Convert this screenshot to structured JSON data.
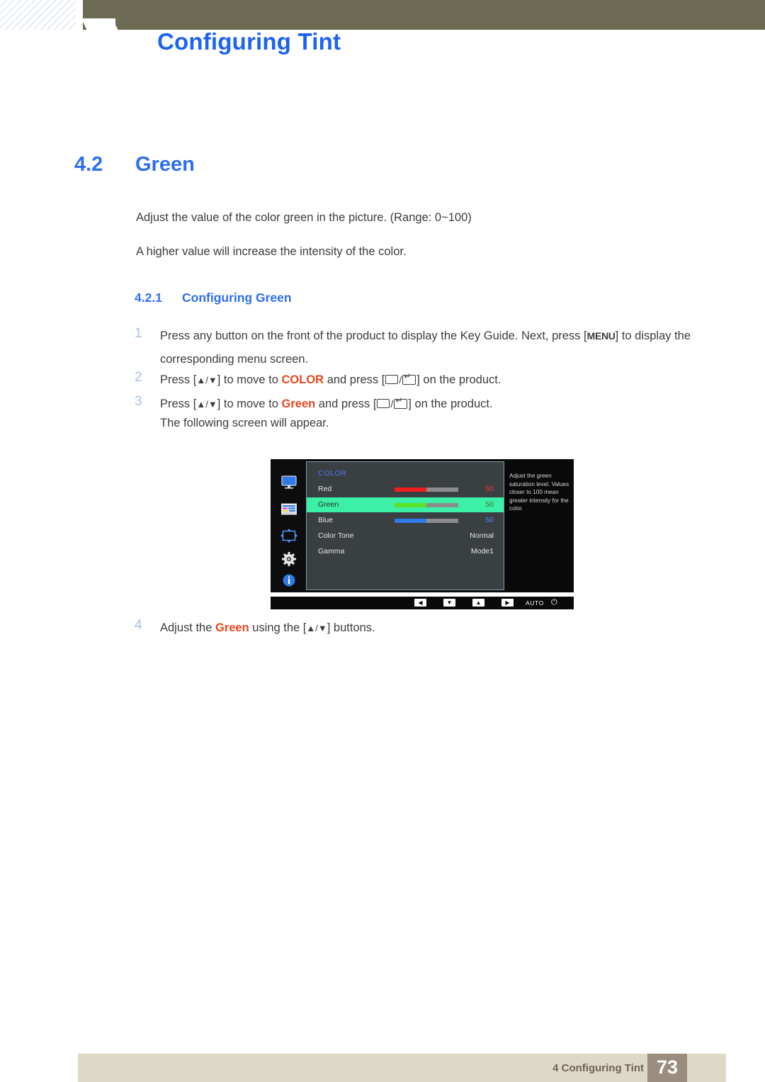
{
  "header": {
    "chapter_number": "4",
    "title": "Configuring Tint"
  },
  "section": {
    "number": "4.2",
    "title": "Green",
    "paragraphs": [
      "Adjust the value of the color green in the picture. (Range: 0~100)",
      "A higher value will increase the intensity of the color."
    ]
  },
  "subsection": {
    "number": "4.2.1",
    "title": "Configuring Green"
  },
  "steps": [
    {
      "num": "1",
      "text_a": "Press any button on the front of the product to display the Key Guide. Next, press [",
      "key": "MENU",
      "text_b": "] to display the corresponding menu screen."
    },
    {
      "num": "2",
      "text_a": "Press [",
      "arrows": "▲/▼",
      "text_b": "] to move to ",
      "keyword": "COLOR",
      "text_c": " and press [",
      "text_d": "] on the product."
    },
    {
      "num": "3",
      "text_a": "Press [",
      "arrows": "▲/▼",
      "text_b": "] to move to ",
      "keyword": "Green",
      "text_c": " and press [",
      "text_d": "] on the product."
    },
    {
      "num": "4",
      "text_a": "Adjust the ",
      "keyword": "Green",
      "text_b": " using the [",
      "arrows": "▲/▼",
      "text_c": "] buttons."
    }
  ],
  "step3_followup": "The following screen will appear.",
  "osd": {
    "menu_title": "COLOR",
    "icons": [
      {
        "name": "display-icon"
      },
      {
        "name": "color-icon"
      },
      {
        "name": "size-position-icon"
      },
      {
        "name": "setup-and-reset-icon"
      },
      {
        "name": "information-icon"
      }
    ],
    "rows": [
      {
        "label": "Red",
        "value": "50",
        "slider": true,
        "fill_color": "#ef1d1d",
        "value_color": "#ef3b3b",
        "percent": 50
      },
      {
        "label": "Green",
        "value": "50",
        "slider": true,
        "fill_color": "#5ce226",
        "value_color": "#4c6b34",
        "percent": 50,
        "selected": true
      },
      {
        "label": "Blue",
        "value": "50",
        "slider": true,
        "fill_color": "#2f7ae5",
        "value_color": "#4f8fe8",
        "percent": 50
      },
      {
        "label": "Color Tone",
        "value": "Normal",
        "slider": false
      },
      {
        "label": "Gamma",
        "value": "Mode1",
        "slider": false
      }
    ],
    "help_text": "Adjust the green saturation level. Values closer to 100 mean greater intensity for the color.",
    "buttons": {
      "left": "◀",
      "down": "▼",
      "up": "▲",
      "right": "▶",
      "auto": "AUTO",
      "power": "⏻"
    }
  },
  "footer": {
    "text": "4 Configuring Tint",
    "page": "73"
  },
  "colors": {
    "accent_blue": "#2d6ef5",
    "header_olive": "#6e6b55",
    "keyword_red": "#e8451f",
    "step_num_blue": "#a8c2e8",
    "footer_tan": "#ded9c6",
    "footer_page_box": "#9b8d7d",
    "osd_panel": "#3a3f42",
    "osd_selected_green": "#3cf0a8"
  }
}
